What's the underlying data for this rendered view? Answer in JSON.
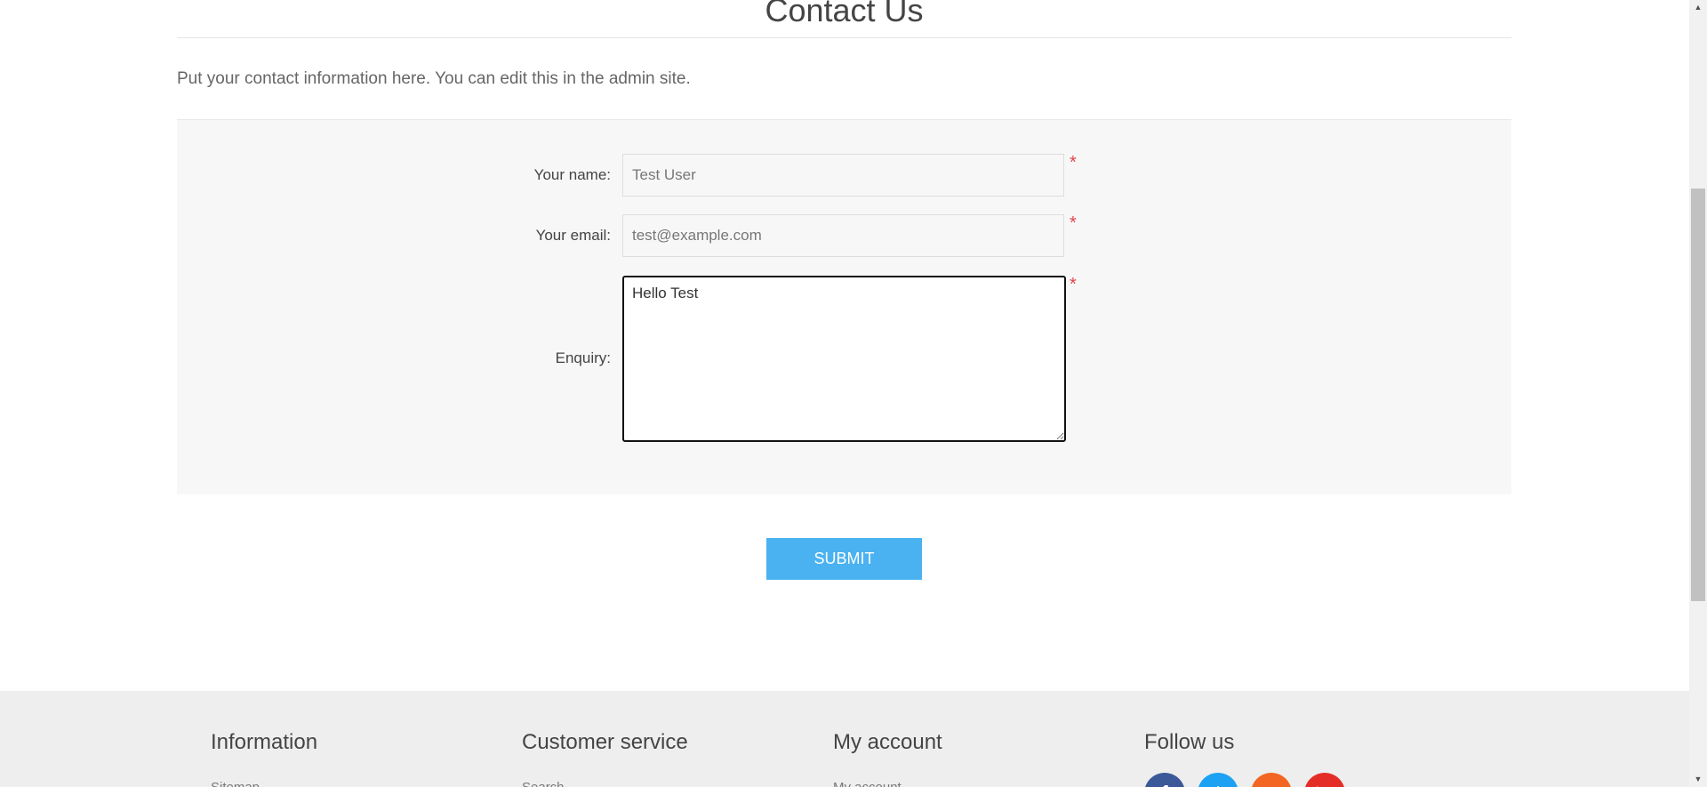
{
  "page": {
    "title": "Contact Us",
    "topic": "Put your contact information here. You can edit this in the admin site."
  },
  "form": {
    "name": {
      "label": "Your name:",
      "value": "Test User",
      "required": "*"
    },
    "email": {
      "label": "Your email:",
      "value": "test@example.com",
      "required": "*"
    },
    "enquiry": {
      "label": "Enquiry:",
      "value": "Hello Test",
      "required": "*"
    },
    "submit_label": "SUBMIT"
  },
  "footer": {
    "columns": [
      {
        "title": "Information",
        "first_link": "Sitemap"
      },
      {
        "title": "Customer service",
        "first_link": "Search"
      },
      {
        "title": "My account",
        "first_link": "My account"
      },
      {
        "title": "Follow us"
      }
    ],
    "social": [
      {
        "icon": "facebook-icon",
        "glyph": "f",
        "color": "#3b5998"
      },
      {
        "icon": "twitter-icon",
        "glyph": "t",
        "color": "#1da1f2"
      },
      {
        "icon": "rss-icon",
        "glyph": "r",
        "color": "#f26522"
      },
      {
        "icon": "youtube-icon",
        "glyph": "▶",
        "color": "#e52d27"
      }
    ]
  },
  "colors": {
    "accent": "#4ab2f1",
    "required": "#e4434b"
  }
}
